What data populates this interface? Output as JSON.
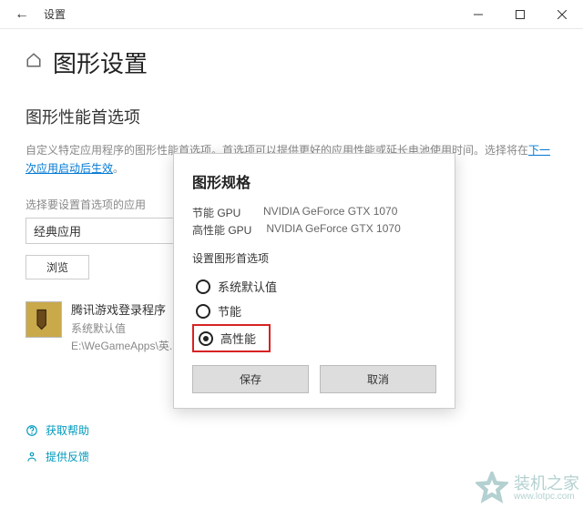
{
  "titlebar": {
    "title": "设置"
  },
  "page": {
    "heading": "图形设置",
    "subheading": "图形性能首选项",
    "desc_prefix": "自定义特定应用程序的图形性能首选项。首选项可以提供更好的应用性能或延长电池使用时间。选择将在",
    "desc_link": "下一次应用启动后生效",
    "desc_suffix": "。",
    "select_label": "选择要设置首选项的应用",
    "combo_value": "经典应用",
    "browse_label": "浏览",
    "app": {
      "name": "腾讯游戏登录程序",
      "default_label": "系统默认值",
      "path": "E:\\WeGameApps\\英..."
    }
  },
  "dialog": {
    "title": "图形规格",
    "gpu_saving_label": "节能 GPU",
    "gpu_saving_value": "NVIDIA GeForce GTX 1070",
    "gpu_perf_label": "高性能 GPU",
    "gpu_perf_value": "NVIDIA GeForce GTX 1070",
    "section_label": "设置图形首选项",
    "options": {
      "default": "系统默认值",
      "saving": "节能",
      "performance": "高性能"
    },
    "save": "保存",
    "cancel": "取消"
  },
  "footer": {
    "help": "获取帮助",
    "feedback": "提供反馈"
  },
  "watermark": {
    "name": "装机之家",
    "url": "www.lotpc.com"
  }
}
